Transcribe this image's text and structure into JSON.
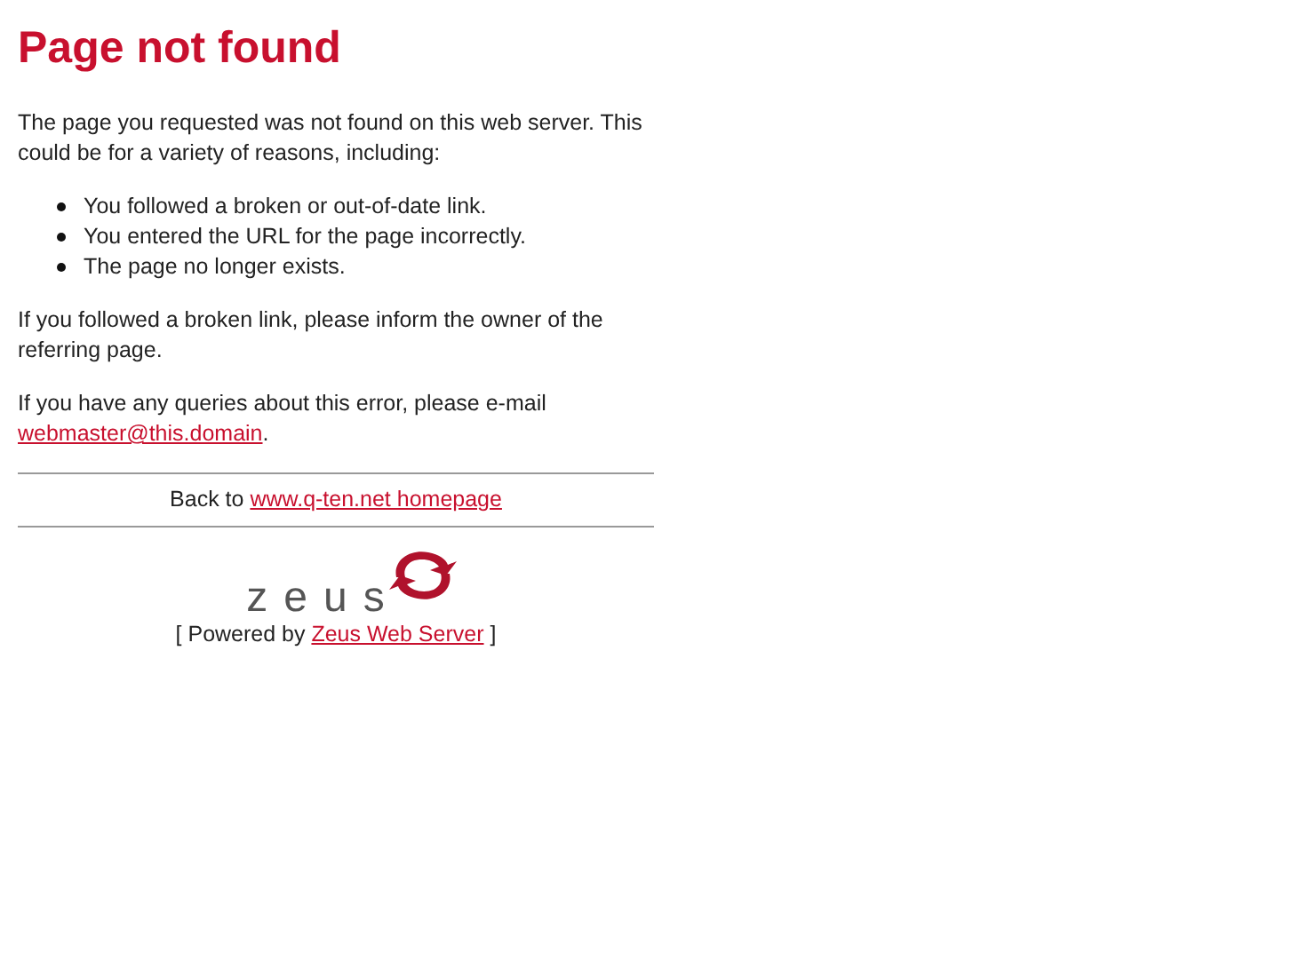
{
  "title": "Page not found",
  "intro": "The page you requested was not found on this web server. This could be for a variety of reasons, including:",
  "reasons": [
    "You followed a broken or out-of-date link.",
    "You entered the URL for the page incorrectly.",
    "The page no longer exists."
  ],
  "broken_link_note": "If you followed a broken link, please inform the owner of the referring page.",
  "contact": {
    "text": "If you have any queries about this error, please e-mail ",
    "link": "webmaster@this.domain",
    "after": "."
  },
  "back": {
    "text": "Back to ",
    "link": "www.q-ten.net homepage"
  },
  "logo": {
    "wordmark": "zeus"
  },
  "powered": {
    "before": "[ Powered by ",
    "link": "Zeus Web Server",
    "after": " ]"
  }
}
